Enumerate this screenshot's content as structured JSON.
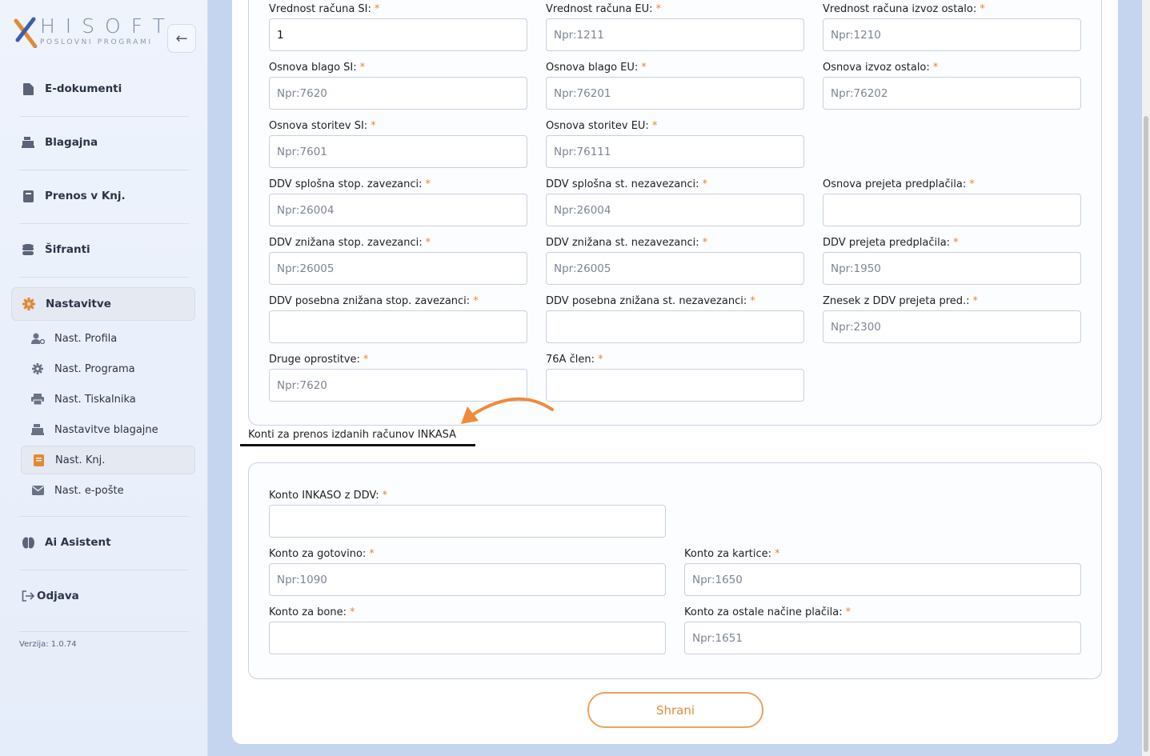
{
  "sidebar": {
    "logo_text": "HISOFT",
    "logo_sub": "POSLOVNI PROGRAMI",
    "back_icon": "arrow-left-icon",
    "items": [
      {
        "label": "E-dokumenti",
        "icon": "document-icon"
      },
      {
        "label": "Blagajna",
        "icon": "cash-register-icon"
      },
      {
        "label": "Prenos v Knj.",
        "icon": "book-icon"
      },
      {
        "label": "Šifranti",
        "icon": "database-icon"
      },
      {
        "label": "Nastavitve",
        "icon": "gear-icon"
      },
      {
        "label": "Ai Asistent",
        "icon": "brain-icon"
      },
      {
        "label": "Odjava",
        "icon": "logout-icon"
      }
    ],
    "sub_items": [
      {
        "label": "Nast. Profila",
        "icon": "user-gear-icon"
      },
      {
        "label": "Nast. Programa",
        "icon": "gear-icon"
      },
      {
        "label": "Nast. Tiskalnika",
        "icon": "printer-icon"
      },
      {
        "label": "Nastavitve blagajne",
        "icon": "cash-register-icon"
      },
      {
        "label": "Nast. Knj.",
        "icon": "book-icon"
      },
      {
        "label": "Nast. e-pošte",
        "icon": "envelope-icon"
      }
    ],
    "version": "Verzija: 1.0.74"
  },
  "form1": {
    "fields": [
      {
        "label": "Vrednost računa SI:",
        "value": "1",
        "placeholder": ""
      },
      {
        "label": "Vrednost računa EU:",
        "value": "",
        "placeholder": "Npr:1211"
      },
      {
        "label": "Vrednost računa izvoz ostalo:",
        "value": "",
        "placeholder": "Npr:1210"
      },
      {
        "label": "Osnova blago SI:",
        "value": "",
        "placeholder": "Npr:7620"
      },
      {
        "label": "Osnova blago EU:",
        "value": "",
        "placeholder": "Npr:76201"
      },
      {
        "label": "Osnova izvoz ostalo:",
        "value": "",
        "placeholder": "Npr:76202"
      },
      {
        "label": "Osnova storitev SI:",
        "value": "",
        "placeholder": "Npr:7601"
      },
      {
        "label": "Osnova storitev EU:",
        "value": "",
        "placeholder": "Npr:76111"
      },
      {
        "label": "DDV splošna stop. zavezanci:",
        "value": "",
        "placeholder": "Npr:26004"
      },
      {
        "label": "DDV splošna st. nezavezanci:",
        "value": "",
        "placeholder": "Npr:26004"
      },
      {
        "label": "Osnova prejeta predplačila:",
        "value": "",
        "placeholder": ""
      },
      {
        "label": "DDV znižana stop. zavezanci:",
        "value": "",
        "placeholder": "Npr:26005"
      },
      {
        "label": "DDV znižana st. nezavezanci:",
        "value": "",
        "placeholder": "Npr:26005"
      },
      {
        "label": "DDV prejeta predplačila:",
        "value": "",
        "placeholder": "Npr:1950"
      },
      {
        "label": "DDV posebna znižana stop. zavezanci:",
        "value": "",
        "placeholder": ""
      },
      {
        "label": "DDV posebna znižana st. nezavezanci:",
        "value": "",
        "placeholder": ""
      },
      {
        "label": "Znesek z DDV prejeta pred.:",
        "value": "",
        "placeholder": "Npr:2300"
      },
      {
        "label": "Druge oprostitve:",
        "value": "",
        "placeholder": "Npr:7620"
      },
      {
        "label": "76A člen:",
        "value": "",
        "placeholder": ""
      }
    ]
  },
  "section_title": "Konti za prenos izdanih računov INKASA",
  "form2": {
    "fields": [
      {
        "label": "Konto INKASO z DDV:",
        "value": "",
        "placeholder": ""
      },
      {
        "label": "Konto za gotovino:",
        "value": "",
        "placeholder": "Npr:1090"
      },
      {
        "label": "Konto za kartice:",
        "value": "",
        "placeholder": "Npr:1650"
      },
      {
        "label": "Konto za bone:",
        "value": "",
        "placeholder": ""
      },
      {
        "label": "Konto za ostale načine plačila:",
        "value": "",
        "placeholder": "Npr:1651"
      }
    ]
  },
  "required_mark": "*",
  "save_label": "Shrani",
  "colors": {
    "accent": "#e08a35",
    "sidebar_bg": "#eef3fc",
    "page_bg": "#c5d4ef"
  }
}
